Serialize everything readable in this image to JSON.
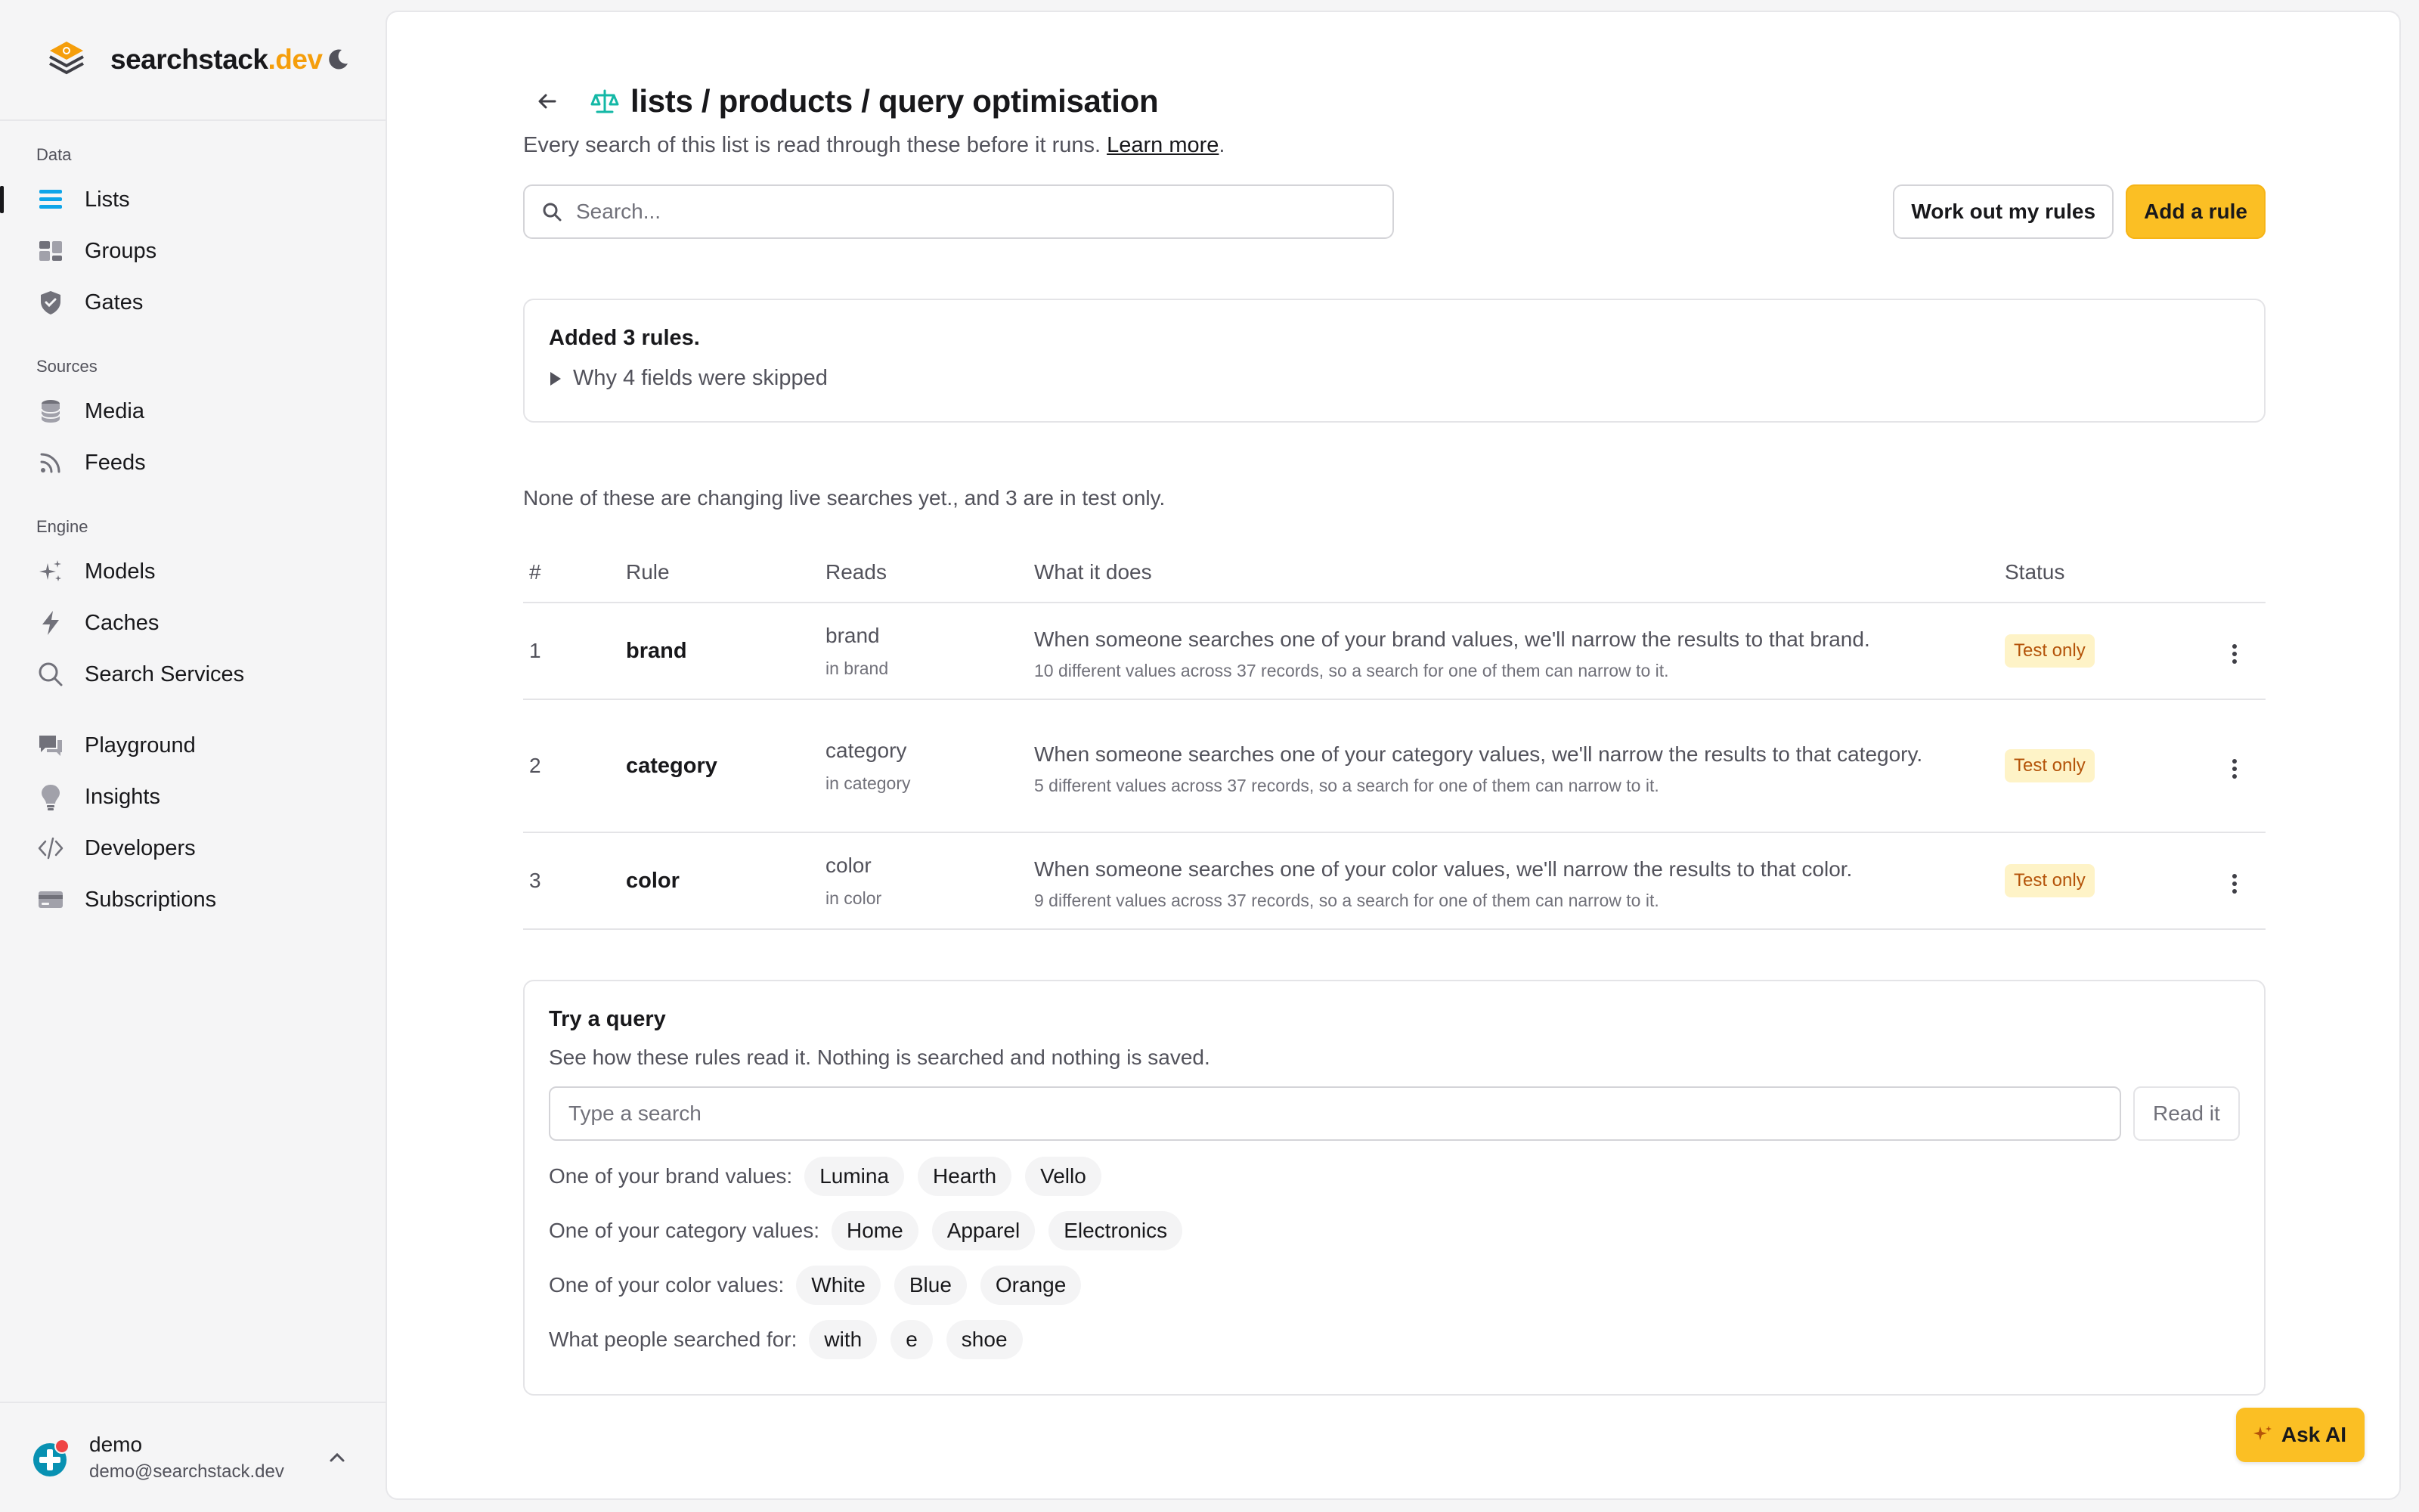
{
  "brand": {
    "name": "searchstack",
    "tld": ".dev"
  },
  "sidebar": {
    "sections": [
      {
        "title": "Data",
        "items": [
          {
            "label": "Lists",
            "icon": "list-icon",
            "active": true
          },
          {
            "label": "Groups",
            "icon": "groups-icon"
          },
          {
            "label": "Gates",
            "icon": "shield-icon"
          }
        ]
      },
      {
        "title": "Sources",
        "items": [
          {
            "label": "Media",
            "icon": "database-icon"
          },
          {
            "label": "Feeds",
            "icon": "rss-icon"
          }
        ]
      },
      {
        "title": "Engine",
        "items": [
          {
            "label": "Models",
            "icon": "sparkles-icon"
          },
          {
            "label": "Caches",
            "icon": "bolt-icon"
          },
          {
            "label": "Search Services",
            "icon": "search-icon"
          }
        ]
      },
      {
        "title": "",
        "items": [
          {
            "label": "Playground",
            "icon": "chat-icon"
          },
          {
            "label": "Insights",
            "icon": "lightbulb-icon"
          },
          {
            "label": "Developers",
            "icon": "code-icon"
          },
          {
            "label": "Subscriptions",
            "icon": "card-icon"
          }
        ]
      }
    ]
  },
  "user": {
    "name": "demo",
    "email": "demo@searchstack.dev"
  },
  "page": {
    "title": "lists / products / query optimisation",
    "subtitle": "Every search of this list is read through these before it runs.",
    "learn_more": "Learn more",
    "period": ".",
    "search_placeholder": "Search...",
    "work_out_label": "Work out my rules",
    "add_rule_label": "Add a rule"
  },
  "notice": {
    "title": "Added 3 rules.",
    "details": "Why 4 fields were skipped"
  },
  "summary": "None of these are changing live searches yet., and 3 are in test only.",
  "table": {
    "headers": {
      "num": "#",
      "rule": "Rule",
      "reads": "Reads",
      "what": "What it does",
      "status": "Status"
    },
    "rows": [
      {
        "num": "1",
        "rule": "brand",
        "reads": "brand",
        "reads_sub": "in brand",
        "what": "When someone searches one of your brand values, we'll narrow the results to that brand.",
        "what_sub": "10 different values across 37 records, so a search for one of them can narrow to it.",
        "status": "Test only"
      },
      {
        "num": "2",
        "rule": "category",
        "reads": "category",
        "reads_sub": "in category",
        "what": "When someone searches one of your category values, we'll narrow the results to that category.",
        "what_sub": "5 different values across 37 records, so a search for one of them can narrow to it.",
        "status": "Test only"
      },
      {
        "num": "3",
        "rule": "color",
        "reads": "color",
        "reads_sub": "in color",
        "what": "When someone searches one of your color values, we'll narrow the results to that color.",
        "what_sub": "9 different values across 37 records, so a search for one of them can narrow to it.",
        "status": "Test only"
      }
    ]
  },
  "try": {
    "title": "Try a query",
    "subtitle": "See how these rules read it. Nothing is searched and nothing is saved.",
    "placeholder": "Type a search",
    "read_label": "Read it",
    "groups": [
      {
        "label": "One of your brand values:",
        "chips": [
          "Lumina",
          "Hearth",
          "Vello"
        ]
      },
      {
        "label": "One of your category values:",
        "chips": [
          "Home",
          "Apparel",
          "Electronics"
        ]
      },
      {
        "label": "One of your color values:",
        "chips": [
          "White",
          "Blue",
          "Orange"
        ]
      },
      {
        "label": "What people searched for:",
        "chips": [
          "with",
          "e",
          "shoe"
        ]
      }
    ]
  },
  "ask_ai": "Ask AI",
  "colors": {
    "accent": "#fbbf24",
    "brand_tld": "#f59e0b",
    "badge_bg": "#fef3c7",
    "badge_text": "#b45309",
    "list_icon": "#0ea5e9",
    "scale_icon": "#14b8a6"
  }
}
